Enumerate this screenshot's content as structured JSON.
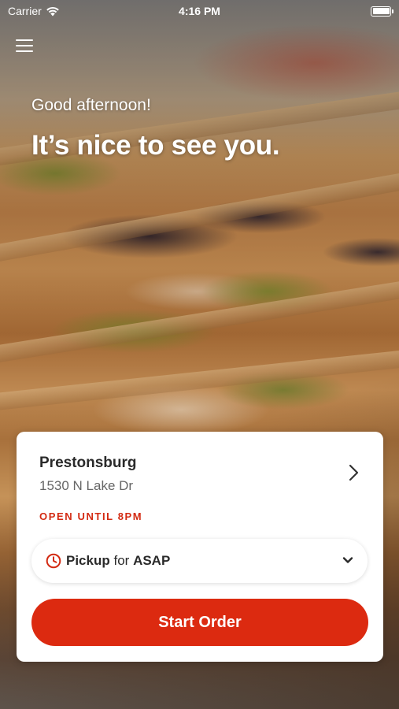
{
  "status_bar": {
    "carrier": "Carrier",
    "time": "4:16 PM"
  },
  "greeting": "Good afternoon!",
  "headline": "It’s nice to see you.",
  "store": {
    "name": "Prestonsburg",
    "address": "1530 N Lake Dr",
    "hours": "OPEN UNTIL 8PM"
  },
  "order_mode": {
    "method": "Pickup",
    "connector": "for",
    "time": "ASAP"
  },
  "start_order_label": "Start Order",
  "colors": {
    "accent": "#dc2a10",
    "hours_text": "#d32a12",
    "card_bg": "#ffffff"
  },
  "icons": {
    "menu": "hamburger-menu-icon",
    "store_nav": "chevron-right-icon",
    "time": "clock-icon",
    "dropdown": "chevron-down-icon",
    "wifi": "wifi-icon",
    "battery": "battery-icon"
  }
}
